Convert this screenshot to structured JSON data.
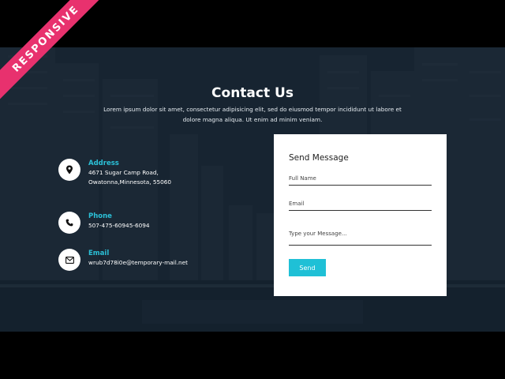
{
  "badge": {
    "text": "RESPONSIVE",
    "color": "#e8316e"
  },
  "header": {
    "title": "Contact Us",
    "subtitle": "Lorem ipsum dolor sit amet, consectetur adipisicing elit, sed do eiusmod tempor incididunt ut labore et dolore magna aliqua. Ut enim ad minim veniam."
  },
  "contact": {
    "address": {
      "label": "Address",
      "value": "4671 Sugar Camp Road, Owatonna,Minnesota, 55060",
      "icon": "map-pin-icon"
    },
    "phone": {
      "label": "Phone",
      "value": "507-475-60945-6094",
      "icon": "phone-icon"
    },
    "email": {
      "label": "Email",
      "value": "wrub7d78i0e@temporary-mail.net",
      "icon": "envelope-icon"
    }
  },
  "form": {
    "title": "Send Message",
    "full_name_placeholder": "Full Name",
    "email_placeholder": "Email",
    "message_placeholder": "Type your Message...",
    "send_label": "Send"
  },
  "colors": {
    "accent": "#2bc0d7",
    "button": "#1fc0d6",
    "background": "#1a2a37"
  }
}
